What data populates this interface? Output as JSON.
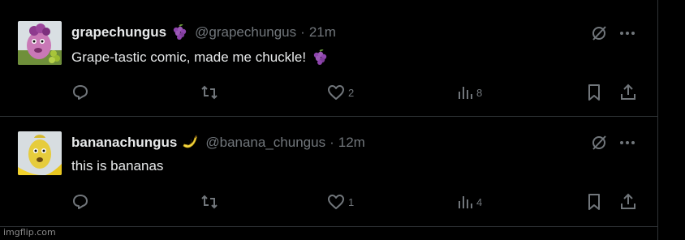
{
  "posts": [
    {
      "display_name": "grapechungus",
      "name_emoji": "grapes-emoji",
      "handle": "@grapechungus",
      "separator": "·",
      "time": "21m",
      "text": "Grape-tastic comic, made me chuckle!",
      "text_emoji": "grapes-emoji",
      "replies": "",
      "reposts": "",
      "likes": "2",
      "views": "8"
    },
    {
      "display_name": "bananachungus",
      "name_emoji": "banana-emoji",
      "handle": "@banana_chungus",
      "separator": "·",
      "time": "12m",
      "text": "this is bananas",
      "text_emoji": "",
      "replies": "",
      "reposts": "",
      "likes": "1",
      "views": "4"
    }
  ],
  "watermark": "imgflip.com",
  "colors": {
    "background": "#000000",
    "text_primary": "#e7e9ea",
    "text_secondary": "#71767b",
    "divider": "#2f3336",
    "grape": "#8e44ad",
    "banana": "#f5d742"
  }
}
